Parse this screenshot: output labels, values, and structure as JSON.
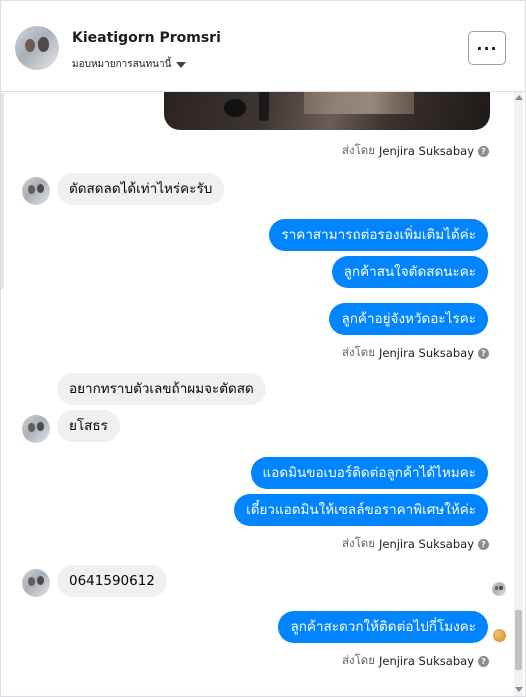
{
  "header": {
    "name": "Kieatigorn Promsri",
    "subtitle": "มอบหมายการสนทนานี้",
    "more_label": "···"
  },
  "sent_by": {
    "prefix": "ส่งโดย",
    "agent": "Jenjira Suksabay",
    "help_glyph": "?"
  },
  "messages": [
    {
      "from": "customer",
      "text": "ตัดสดลดได้เท่าไหร่คะรับ"
    },
    {
      "from": "page",
      "text": "ราคาสามารถต่อรองเพิ่มเติมได้ค่ะ"
    },
    {
      "from": "page",
      "text": "ลูกค้าสนใจตัดสดนะคะ"
    },
    {
      "from": "page",
      "text": "ลูกค้าอยู่จังหวัดอะไรคะ"
    },
    {
      "from": "customer",
      "text": "อยากทราบตัวเลขถ้าผมจะตัดสด"
    },
    {
      "from": "customer",
      "text": "ยโสธร"
    },
    {
      "from": "page",
      "text": "แอดมินขอเบอร์ติดต่อลูกค้าได้ไหมคะ"
    },
    {
      "from": "page",
      "text": "เดี๋ยวแอดมินให้เซลล์ขอราคาพิเศษให้ค่ะ"
    },
    {
      "from": "customer",
      "text": "0641590612"
    },
    {
      "from": "page",
      "text": "ลูกค้าสะดวกให้ติดต่อไปกี่โมงคะ"
    }
  ],
  "icons": {
    "caret": "caret-down-icon",
    "more": "more-horizontal-icon",
    "help": "question-circle-icon"
  },
  "colors": {
    "outgoing_bubble": "#0084ff",
    "incoming_bubble": "#f0f0f0",
    "meta_text": "#65676b"
  }
}
